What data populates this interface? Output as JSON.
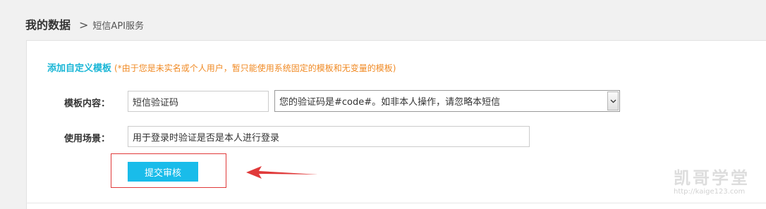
{
  "breadcrumb": {
    "root": "我的数据",
    "separator": ">",
    "current": "短信API服务"
  },
  "form": {
    "section_title": "添加自定义模板",
    "section_note": "(*由于您是未实名或个人用户，暂只能使用系统固定的模板和无变量的模板)",
    "template_label": "模板内容：",
    "template_name_value": "短信验证码",
    "template_content_selected": "您的验证码是#code#。如非本人操作，请忽略本短信",
    "scene_label": "使用场景：",
    "scene_value": "用于登录时验证是否是本人进行登录",
    "submit_label": "提交审核"
  },
  "annotation": {
    "color": "#e03a3a"
  },
  "watermark": {
    "title": "凯哥学堂",
    "url": "http://kaige123.com"
  },
  "colors": {
    "accent": "#19bcea",
    "title": "#19b6d6",
    "note": "#f08a24"
  }
}
